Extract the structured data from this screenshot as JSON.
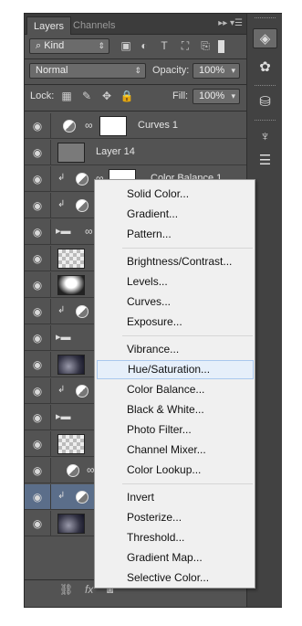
{
  "tabs": [
    "Layers",
    "Channels"
  ],
  "filter": {
    "kind_label": "Kind"
  },
  "blend": {
    "mode": "Normal",
    "opacity_label": "Opacity:",
    "opacity_value": "100%"
  },
  "lock": {
    "label": "Lock:",
    "fill_label": "Fill:",
    "fill_value": "100%"
  },
  "layers": [
    {
      "name": "Curves 1"
    },
    {
      "name": "Layer 14"
    },
    {
      "name": "Color Balance 1"
    }
  ],
  "menu": {
    "items": [
      "Solid Color...",
      "Gradient...",
      "Pattern...",
      "Brightness/Contrast...",
      "Levels...",
      "Curves...",
      "Exposure...",
      "Vibrance...",
      "Hue/Saturation...",
      "Color Balance...",
      "Black & White...",
      "Photo Filter...",
      "Channel Mixer...",
      "Color Lookup...",
      "Invert",
      "Posterize...",
      "Threshold...",
      "Gradient Map...",
      "Selective Color..."
    ],
    "highlighted": "Hue/Saturation..."
  },
  "bottombar": {
    "fx_label": "fx"
  },
  "colors": {
    "panel": "#535353",
    "dock": "#424242",
    "menu_bg": "#f0f0f0",
    "highlight_marker": "#f06e8c",
    "selected_layer": "#5b6e8a"
  }
}
